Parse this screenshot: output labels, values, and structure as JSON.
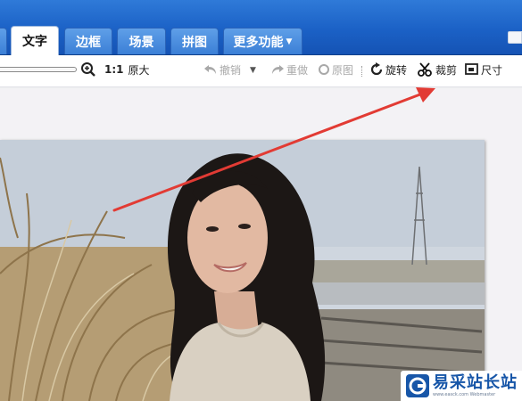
{
  "tabs": [
    {
      "label": "文字",
      "active": true
    },
    {
      "label": "边框",
      "active": false
    },
    {
      "label": "场景",
      "active": false
    },
    {
      "label": "拼图",
      "active": false
    },
    {
      "label": "更多功能",
      "active": false,
      "has_dropdown": true
    }
  ],
  "toolbar": {
    "zoom_ratio": "1:1",
    "actual_size_label": "原大",
    "undo_label": "撤销",
    "redo_label": "重做",
    "original_label": "原图",
    "rotate_label": "旋转",
    "crop_label": "裁剪",
    "resize_label": "尺寸"
  },
  "colors": {
    "tab_bar": "#1b61c6",
    "arrow": "#e23b34",
    "watermark_text": "#1756a8"
  },
  "watermark": {
    "title": "易采站长站",
    "subtitle": "www.easck.com Webmaster"
  }
}
